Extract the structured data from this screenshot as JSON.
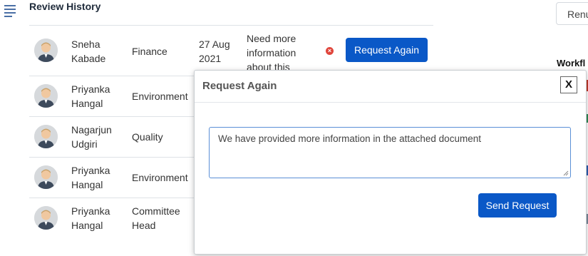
{
  "header": {
    "title": "Review History",
    "top_button_label": "Renu",
    "workflow_label": "Workfl"
  },
  "table": {
    "rows": [
      {
        "name_line1": "Sneha",
        "name_line2": "Kabade",
        "department": "Finance",
        "date_line1": "27 Aug",
        "date_line2": "2021",
        "reason_line1": "Need more",
        "reason_line2": "information",
        "reason_line3": "about this",
        "action_label": "Request Again"
      },
      {
        "name_line1": "Priyanka",
        "name_line2": "Hangal",
        "department": "Environment"
      },
      {
        "name_line1": "Nagarjun",
        "name_line2": "Udgiri",
        "department": "Quality"
      },
      {
        "name_line1": "Priyanka",
        "name_line2": "Hangal",
        "department": "Environment"
      },
      {
        "name_line1": "Priyanka",
        "name_line2": "Hangal",
        "department_line1": "Committee",
        "department_line2": "Head"
      }
    ]
  },
  "modal": {
    "title": "Request Again",
    "close_label": "X",
    "message_value": "We have provided more information in the attached document",
    "send_label": "Send Request"
  },
  "colors": {
    "primary": "#0a58c7",
    "danger": "#e0453b",
    "edge_red": "#c0392b",
    "edge_green": "#2e8b57",
    "edge_blue": "#2a5db0"
  }
}
